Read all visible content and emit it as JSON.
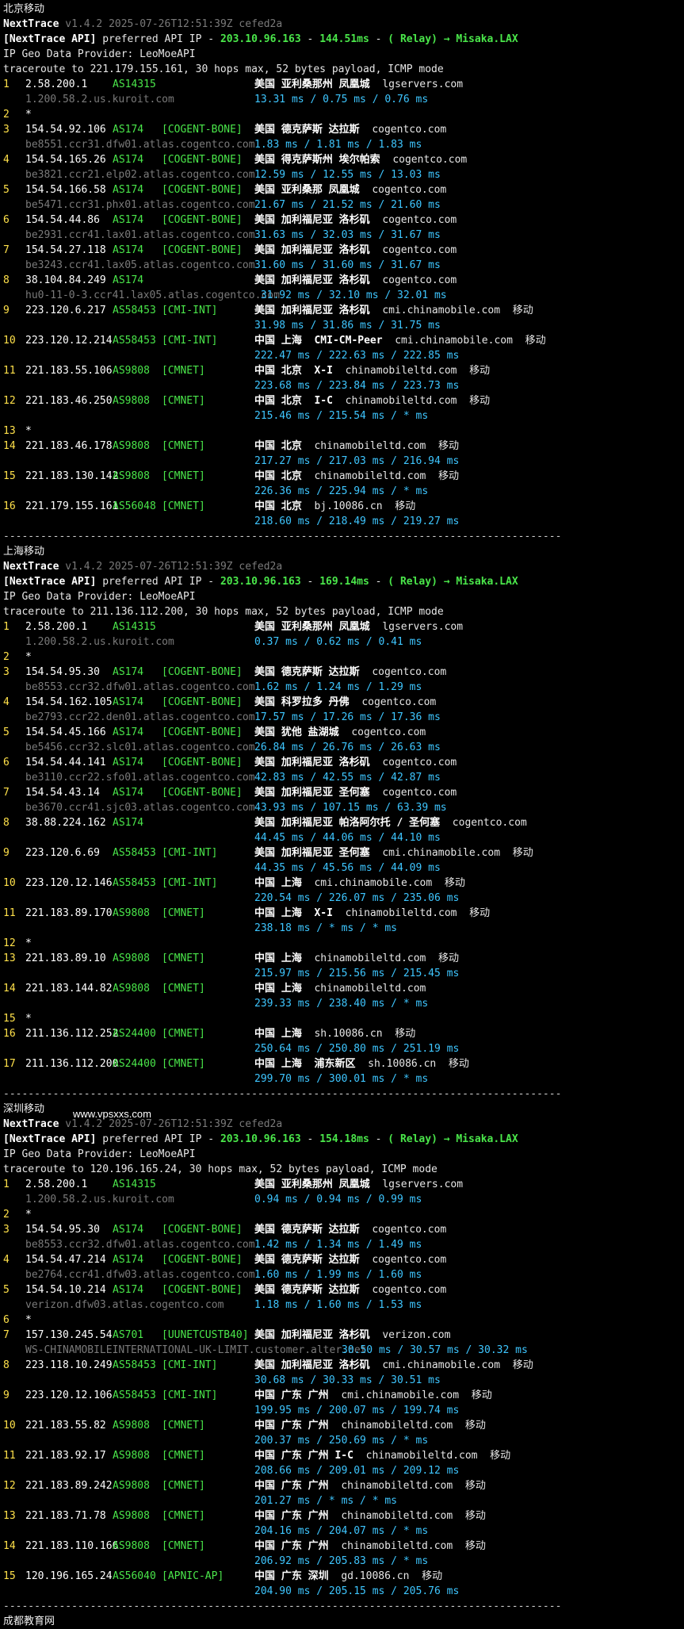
{
  "watermark": "www.vpsxxs.com",
  "sections": [
    {
      "title": "北京移动",
      "header": {
        "app": "NextTrace",
        "version": "v1.4.2 2025-07-26T12:51:39Z cefed2a",
        "api_prefix": "[NextTrace API]",
        "api_text": "preferred API IP - ",
        "api_ip": "203.10.96.163",
        "api_ms": "144.51ms",
        "relay": "( Relay) → Misaka.LAX",
        "geo_provider": "IP Geo Data Provider: LeoMoeAPI",
        "traceroute": "traceroute to 221.179.155.161, 30 hops max, 52 bytes payload, ICMP mode"
      },
      "hops": [
        {
          "n": "1",
          "ip": "2.58.200.1",
          "asn": "AS14315",
          "tag": "",
          "geo": "美国 亚利桑那州 凤凰城",
          "org": "lgservers.com",
          "isp": "",
          "rdns": "1.200.58.2.us.kuroit.com",
          "rtt": "13.31 ms / 0.75 ms / 0.76 ms"
        },
        {
          "n": "2",
          "star": true
        },
        {
          "n": "3",
          "ip": "154.54.92.106",
          "asn": "AS174",
          "tag": "[COGENT-BONE]",
          "geo": "美国 德克萨斯 达拉斯",
          "org": "cogentco.com",
          "isp": "",
          "rdns": "be8551.ccr31.dfw01.atlas.cogentco.com",
          "rtt": "1.83 ms / 1.81 ms / 1.83 ms"
        },
        {
          "n": "4",
          "ip": "154.54.165.26",
          "asn": "AS174",
          "tag": "[COGENT-BONE]",
          "geo": "美国 得克萨斯州 埃尔帕索",
          "org": "cogentco.com",
          "isp": "",
          "rdns": "be3821.ccr21.elp02.atlas.cogentco.com",
          "rtt": "12.59 ms / 12.55 ms / 13.03 ms"
        },
        {
          "n": "5",
          "ip": "154.54.166.58",
          "asn": "AS174",
          "tag": "[COGENT-BONE]",
          "geo": "美国 亚利桑那 凤凰城",
          "org": "cogentco.com",
          "isp": "",
          "rdns": "be5471.ccr31.phx01.atlas.cogentco.com",
          "rtt": "21.67 ms / 21.52 ms / 21.60 ms"
        },
        {
          "n": "6",
          "ip": "154.54.44.86",
          "asn": "AS174",
          "tag": "[COGENT-BONE]",
          "geo": "美国 加利福尼亚 洛杉矶",
          "org": "cogentco.com",
          "isp": "",
          "rdns": "be2931.ccr41.lax01.atlas.cogentco.com",
          "rtt": "31.63 ms / 32.03 ms / 31.67 ms"
        },
        {
          "n": "7",
          "ip": "154.54.27.118",
          "asn": "AS174",
          "tag": "[COGENT-BONE]",
          "geo": "美国 加利福尼亚 洛杉矶",
          "org": "cogentco.com",
          "isp": "",
          "rdns": "be3243.ccr41.lax05.atlas.cogentco.com",
          "rtt": "31.60 ms / 31.60 ms / 31.67 ms"
        },
        {
          "n": "8",
          "ip": "38.104.84.249",
          "asn": "AS174",
          "tag": "",
          "geo": "美国 加利福尼亚 洛杉矶",
          "org": "cogentco.com",
          "isp": "",
          "rdns": "hu0-11-0-3.ccr41.lax05.atlas.cogentco.com",
          "rtt": " 31.92 ms / 32.10 ms / 32.01 ms"
        },
        {
          "n": "9",
          "ip": "223.120.6.217",
          "asn": "AS58453",
          "tag": "[CMI-INT]",
          "geo": "美国 加利福尼亚 洛杉矶",
          "org": "cmi.chinamobile.com",
          "isp": "移动",
          "rdns": "",
          "rtt": "31.98 ms / 31.86 ms / 31.75 ms"
        },
        {
          "n": "10",
          "ip": "223.120.12.214",
          "asn": "AS58453",
          "tag": "[CMI-INT]",
          "geo": "中国 上海  CMI-CM-Peer",
          "org": "cmi.chinamobile.com",
          "isp": "移动",
          "rdns": "",
          "rtt": "222.47 ms / 222.63 ms / 222.85 ms"
        },
        {
          "n": "11",
          "ip": "221.183.55.106",
          "asn": "AS9808",
          "tag": "[CMNET]",
          "geo": "中国 北京  X-I",
          "org": "chinamobileltd.com",
          "isp": "移动",
          "rdns": "",
          "rtt": "223.68 ms / 223.84 ms / 223.73 ms"
        },
        {
          "n": "12",
          "ip": "221.183.46.250",
          "asn": "AS9808",
          "tag": "[CMNET]",
          "geo": "中国 北京  I-C",
          "org": "chinamobileltd.com",
          "isp": "移动",
          "rdns": "",
          "rtt": "215.46 ms / 215.54 ms / * ms"
        },
        {
          "n": "13",
          "star": true
        },
        {
          "n": "14",
          "ip": "221.183.46.178",
          "asn": "AS9808",
          "tag": "[CMNET]",
          "geo": "中国 北京",
          "org": "chinamobileltd.com",
          "isp": "移动",
          "rdns": "",
          "rtt": "217.27 ms / 217.03 ms / 216.94 ms"
        },
        {
          "n": "15",
          "ip": "221.183.130.142",
          "asn": "AS9808",
          "tag": "[CMNET]",
          "geo": "中国 北京",
          "org": "chinamobileltd.com",
          "isp": "移动",
          "rdns": "",
          "rtt": "226.36 ms / 225.94 ms / * ms"
        },
        {
          "n": "16",
          "ip": "221.179.155.161",
          "asn": "AS56048",
          "tag": "[CMNET]",
          "geo": "中国 北京",
          "org": "bj.10086.cn",
          "isp": "移动",
          "rdns": "",
          "rtt": "218.60 ms / 218.49 ms / 219.27 ms"
        }
      ]
    },
    {
      "title": "上海移动",
      "header": {
        "app": "NextTrace",
        "version": "v1.4.2 2025-07-26T12:51:39Z cefed2a",
        "api_prefix": "[NextTrace API]",
        "api_text": "preferred API IP - ",
        "api_ip": "203.10.96.163",
        "api_ms": "169.14ms",
        "relay": "( Relay) → Misaka.LAX",
        "geo_provider": "IP Geo Data Provider: LeoMoeAPI",
        "traceroute": "traceroute to 211.136.112.200, 30 hops max, 52 bytes payload, ICMP mode"
      },
      "hops": [
        {
          "n": "1",
          "ip": "2.58.200.1",
          "asn": "AS14315",
          "tag": "",
          "geo": "美国 亚利桑那州 凤凰城",
          "org": "lgservers.com",
          "isp": "",
          "rdns": "1.200.58.2.us.kuroit.com",
          "rtt": "0.37 ms / 0.62 ms / 0.41 ms"
        },
        {
          "n": "2",
          "star": true
        },
        {
          "n": "3",
          "ip": "154.54.95.30",
          "asn": "AS174",
          "tag": "[COGENT-BONE]",
          "geo": "美国 德克萨斯 达拉斯",
          "org": "cogentco.com",
          "isp": "",
          "rdns": "be8553.ccr32.dfw01.atlas.cogentco.com",
          "rtt": "1.62 ms / 1.24 ms / 1.29 ms"
        },
        {
          "n": "4",
          "ip": "154.54.162.105",
          "asn": "AS174",
          "tag": "[COGENT-BONE]",
          "geo": "美国 科罗拉多 丹佛",
          "org": "cogentco.com",
          "isp": "",
          "rdns": "be2793.ccr22.den01.atlas.cogentco.com",
          "rtt": "17.57 ms / 17.26 ms / 17.36 ms"
        },
        {
          "n": "5",
          "ip": "154.54.45.166",
          "asn": "AS174",
          "tag": "[COGENT-BONE]",
          "geo": "美国 犹他 盐湖城",
          "org": "cogentco.com",
          "isp": "",
          "rdns": "be5456.ccr32.slc01.atlas.cogentco.com",
          "rtt": "26.84 ms / 26.76 ms / 26.63 ms"
        },
        {
          "n": "6",
          "ip": "154.54.44.141",
          "asn": "AS174",
          "tag": "[COGENT-BONE]",
          "geo": "美国 加利福尼亚 洛杉矶",
          "org": "cogentco.com",
          "isp": "",
          "rdns": "be3110.ccr22.sfo01.atlas.cogentco.com",
          "rtt": "42.83 ms / 42.55 ms / 42.87 ms"
        },
        {
          "n": "7",
          "ip": "154.54.43.14",
          "asn": "AS174",
          "tag": "[COGENT-BONE]",
          "geo": "美国 加利福尼亚 圣何塞",
          "org": "cogentco.com",
          "isp": "",
          "rdns": "be3670.ccr41.sjc03.atlas.cogentco.com",
          "rtt": "43.93 ms / 107.15 ms / 63.39 ms"
        },
        {
          "n": "8",
          "ip": "38.88.224.162",
          "asn": "AS174",
          "tag": "",
          "geo": "美国 加利福尼亚 帕洛阿尔托 / 圣何塞",
          "org": "cogentco.com",
          "isp": "",
          "rdns": "",
          "rtt": "44.45 ms / 44.06 ms / 44.10 ms"
        },
        {
          "n": "9",
          "ip": "223.120.6.69",
          "asn": "AS58453",
          "tag": "[CMI-INT]",
          "geo": "美国 加利福尼亚 圣何塞",
          "org": "cmi.chinamobile.com",
          "isp": "移动",
          "rdns": "",
          "rtt": "44.35 ms / 45.56 ms / 44.09 ms"
        },
        {
          "n": "10",
          "ip": "223.120.12.146",
          "asn": "AS58453",
          "tag": "[CMI-INT]",
          "geo": "中国 上海",
          "org": "cmi.chinamobile.com",
          "isp": "移动",
          "rdns": "",
          "rtt": "220.54 ms / 226.07 ms / 235.06 ms"
        },
        {
          "n": "11",
          "ip": "221.183.89.170",
          "asn": "AS9808",
          "tag": "[CMNET]",
          "geo": "中国 上海  X-I",
          "org": "chinamobileltd.com",
          "isp": "移动",
          "rdns": "",
          "rtt": "238.18 ms / * ms / * ms"
        },
        {
          "n": "12",
          "star": true
        },
        {
          "n": "13",
          "ip": "221.183.89.10",
          "asn": "AS9808",
          "tag": "[CMNET]",
          "geo": "中国 上海",
          "org": "chinamobileltd.com",
          "isp": "移动",
          "rdns": "",
          "rtt": "215.97 ms / 215.56 ms / 215.45 ms"
        },
        {
          "n": "14",
          "ip": "221.183.144.82",
          "asn": "AS9808",
          "tag": "[CMNET]",
          "geo": "中国 上海",
          "org": "chinamobileltd.com",
          "isp": "",
          "rdns": "",
          "rtt": "239.33 ms / 238.40 ms / * ms"
        },
        {
          "n": "15",
          "star": true
        },
        {
          "n": "16",
          "ip": "211.136.112.252",
          "asn": "AS24400",
          "tag": "[CMNET]",
          "geo": "中国 上海",
          "org": "sh.10086.cn",
          "isp": "移动",
          "rdns": "",
          "rtt": "250.64 ms / 250.80 ms / 251.19 ms"
        },
        {
          "n": "17",
          "ip": "211.136.112.200",
          "asn": "AS24400",
          "tag": "[CMNET]",
          "geo": "中国 上海  浦东新区",
          "org": "sh.10086.cn",
          "isp": "移动",
          "rdns": "",
          "rtt": "299.70 ms / 300.01 ms / * ms"
        }
      ]
    },
    {
      "title": "深圳移动",
      "header": {
        "app": "NextTrace",
        "version": "v1.4.2 2025-07-26T12:51:39Z cefed2a",
        "api_prefix": "[NextTrace API]",
        "api_text": "preferred API IP - ",
        "api_ip": "203.10.96.163",
        "api_ms": "154.18ms",
        "relay": "( Relay) → Misaka.LAX",
        "geo_provider": "IP Geo Data Provider: LeoMoeAPI",
        "traceroute": "traceroute to 120.196.165.24, 30 hops max, 52 bytes payload, ICMP mode"
      },
      "hops": [
        {
          "n": "1",
          "ip": "2.58.200.1",
          "asn": "AS14315",
          "tag": "",
          "geo": "美国 亚利桑那州 凤凰城",
          "org": "lgservers.com",
          "isp": "",
          "rdns": "1.200.58.2.us.kuroit.com",
          "rtt": "0.94 ms / 0.94 ms / 0.99 ms"
        },
        {
          "n": "2",
          "star": true
        },
        {
          "n": "3",
          "ip": "154.54.95.30",
          "asn": "AS174",
          "tag": "[COGENT-BONE]",
          "geo": "美国 德克萨斯 达拉斯",
          "org": "cogentco.com",
          "isp": "",
          "rdns": "be8553.ccr32.dfw01.atlas.cogentco.com",
          "rtt": "1.42 ms / 1.34 ms / 1.49 ms"
        },
        {
          "n": "4",
          "ip": "154.54.47.214",
          "asn": "AS174",
          "tag": "[COGENT-BONE]",
          "geo": "美国 德克萨斯 达拉斯",
          "org": "cogentco.com",
          "isp": "",
          "rdns": "be2764.ccr41.dfw03.atlas.cogentco.com",
          "rtt": "1.60 ms / 1.99 ms / 1.60 ms"
        },
        {
          "n": "5",
          "ip": "154.54.10.214",
          "asn": "AS174",
          "tag": "[COGENT-BONE]",
          "geo": "美国 德克萨斯 达拉斯",
          "org": "cogentco.com",
          "isp": "",
          "rdns": "verizon.dfw03.atlas.cogentco.com",
          "rtt": "1.18 ms / 1.60 ms / 1.53 ms"
        },
        {
          "n": "6",
          "star": true
        },
        {
          "n": "7",
          "ip": "157.130.245.54",
          "asn": "AS701",
          "tag": "[UUNETCUSTB40]",
          "geo": "美国 加利福尼亚 洛杉矶",
          "org": "verizon.com",
          "isp": "",
          "rdns": "WS-CHINAMOBILEINTERNATIONAL-UK-LIMIT.customer.alter.net",
          "rtt": "30.50 ms / 30.57 ms / 30.32 ms",
          "rtt_inline": true
        },
        {
          "n": "8",
          "ip": "223.118.10.249",
          "asn": "AS58453",
          "tag": "[CMI-INT]",
          "geo": "美国 加利福尼亚 洛杉矶",
          "org": "cmi.chinamobile.com",
          "isp": "移动",
          "rdns": "",
          "rtt": "30.68 ms / 30.33 ms / 30.51 ms"
        },
        {
          "n": "9",
          "ip": "223.120.12.106",
          "asn": "AS58453",
          "tag": "[CMI-INT]",
          "geo": "中国 广东 广州",
          "org": "cmi.chinamobile.com",
          "isp": "移动",
          "rdns": "",
          "rtt": "199.95 ms / 200.07 ms / 199.74 ms"
        },
        {
          "n": "10",
          "ip": "221.183.55.82",
          "asn": "AS9808",
          "tag": "[CMNET]",
          "geo": "中国 广东 广州",
          "org": "chinamobileltd.com",
          "isp": "移动",
          "rdns": "",
          "rtt": "200.37 ms / 250.69 ms / * ms"
        },
        {
          "n": "11",
          "ip": "221.183.92.17",
          "asn": "AS9808",
          "tag": "[CMNET]",
          "geo": "中国 广东 广州 I-C",
          "org": "chinamobileltd.com",
          "isp": "移动",
          "rdns": "",
          "rtt": "208.66 ms / 209.01 ms / 209.12 ms"
        },
        {
          "n": "12",
          "ip": "221.183.89.242",
          "asn": "AS9808",
          "tag": "[CMNET]",
          "geo": "中国 广东 广州",
          "org": "chinamobileltd.com",
          "isp": "移动",
          "rdns": "",
          "rtt": "201.27 ms / * ms / * ms"
        },
        {
          "n": "13",
          "ip": "221.183.71.78",
          "asn": "AS9808",
          "tag": "[CMNET]",
          "geo": "中国 广东 广州",
          "org": "chinamobileltd.com",
          "isp": "移动",
          "rdns": "",
          "rtt": "204.16 ms / 204.07 ms / * ms"
        },
        {
          "n": "14",
          "ip": "221.183.110.166",
          "asn": "AS9808",
          "tag": "[CMNET]",
          "geo": "中国 广东 广州",
          "org": "chinamobileltd.com",
          "isp": "移动",
          "rdns": "",
          "rtt": "206.92 ms / 205.83 ms / * ms"
        },
        {
          "n": "15",
          "ip": "120.196.165.24",
          "asn": "AS56040",
          "tag": "[APNIC-AP]",
          "geo": "中国 广东 深圳",
          "org": "gd.10086.cn",
          "isp": "移动",
          "rdns": "",
          "rtt": "204.90 ms / 205.15 ms / 205.76 ms"
        }
      ]
    }
  ],
  "next_section_title": "成都教育网",
  "divider": "------------------------------------------------------------------------------------------"
}
